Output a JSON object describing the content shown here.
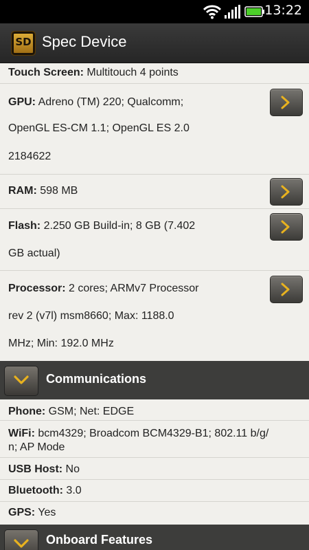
{
  "status": {
    "time": "13:22"
  },
  "app": {
    "title": "Spec Device",
    "icon_text": "SD"
  },
  "items_top": {
    "touch": {
      "label": "Touch Screen:",
      "value": " Multitouch 4 points"
    },
    "gpu": {
      "label": "GPU:",
      "line1": " Adreno (TM) 220; Qualcomm;",
      "line2": "OpenGL ES-CM 1.1; OpenGL ES 2.0",
      "line3": "2184622"
    },
    "ram": {
      "label": "RAM:",
      "value": " 598 MB"
    },
    "flash": {
      "label": "Flash:",
      "line1": " 2.250 GB Build-in; 8 GB (7.402",
      "line2": "GB actual)"
    },
    "processor": {
      "label": "Processor:",
      "line1": " 2 cores; ARMv7 Processor",
      "line2": "rev 2 (v7l) msm8660; Max: 1188.0",
      "line3": "MHz; Min: 192.0 MHz"
    }
  },
  "sections": {
    "communications": "Communications",
    "onboard": "Onboard Features"
  },
  "items_comm": {
    "phone": {
      "label": "Phone:",
      "value": " GSM; Net: EDGE"
    },
    "wifi": {
      "label": "WiFi:",
      "line1": " bcm4329; Broadcom BCM4329-B1; 802.11 b/g/",
      "line2": "n; AP Mode"
    },
    "usb": {
      "label": "USB Host:",
      "value": " No"
    },
    "bluetooth": {
      "label": "Bluetooth:",
      "value": " 3.0"
    },
    "gps": {
      "label": "GPS:",
      "value": " Yes"
    }
  },
  "icons": {
    "arrow": "chevron-right-icon",
    "toggle": "chevron-down-icon",
    "accent": "#e8b21f"
  }
}
